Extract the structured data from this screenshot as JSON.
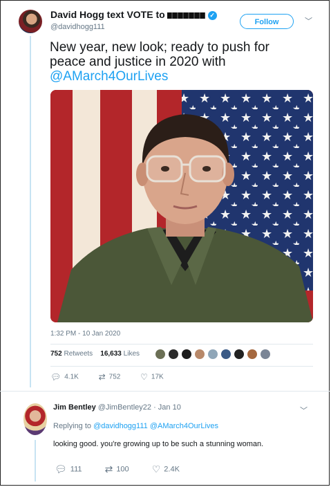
{
  "tweet": {
    "display_name": "David Hogg text VOTE to",
    "handle": "@davidhogg111",
    "follow_label": "Follow",
    "text_main": "New year, new look; ready to push for peace and justice in 2020 with ",
    "text_mention": "@AMarch4OurLives",
    "timestamp": "1:32 PM - 10 Jan 2020",
    "retweets_count": "752",
    "retweets_label": "Retweets",
    "likes_count": "16,633",
    "likes_label": "Likes",
    "actions": {
      "replies": "4.1K",
      "retweets": "752",
      "likes": "17K"
    },
    "icons": {
      "verified": "verified-badge-icon",
      "more": "chevron-down-icon",
      "reply": "reply-icon",
      "retweet": "retweet-icon",
      "like": "heart-icon"
    },
    "liker_colors": [
      "#6b6f55",
      "#2b2b2b",
      "#1c1c1c",
      "#b8896a",
      "#8fa6b8",
      "#3a5a86",
      "#222222",
      "#a5683f",
      "#7a8596"
    ]
  },
  "reply": {
    "name": "Jim Bentley",
    "handle_date": "@JimBentley22 · Jan 10",
    "replying_prefix": "Replying to",
    "replying_to": "@davidhogg111 @AMarch4OurLives",
    "text": "looking good. you're growing up to be such a stunning woman.",
    "actions": {
      "replies": "111",
      "retweets": "100",
      "likes": "2.4K"
    }
  },
  "colors": {
    "accent": "#1da1f2",
    "muted": "#657786",
    "thread_line": "#c7e3f3"
  }
}
